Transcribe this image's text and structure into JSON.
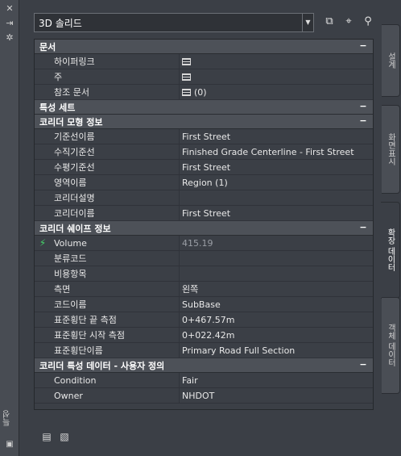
{
  "panel": {
    "title": "특성",
    "left_buttons": [
      {
        "icon": "close-icon",
        "glyph": "✕"
      },
      {
        "icon": "auto-hide-icon",
        "glyph": "⇥"
      },
      {
        "icon": "properties-settings-icon",
        "glyph": "✲"
      }
    ]
  },
  "toolbar": {
    "selector_value": "3D 솔리드",
    "dropdown_glyph": "▼",
    "icons": [
      {
        "name": "toggle-pickadd-icon",
        "glyph": "⧉"
      },
      {
        "name": "select-objects-icon",
        "glyph": "⌖"
      },
      {
        "name": "quick-select-icon",
        "glyph": "⚲"
      }
    ]
  },
  "sections": [
    {
      "title": "문서",
      "rows": [
        {
          "label": "하이퍼링크",
          "value": "",
          "icon": "table-icon"
        },
        {
          "label": "주",
          "value": "",
          "icon": "table-icon"
        },
        {
          "label": "참조 문서",
          "value": "(0)",
          "icon": "table-icon"
        }
      ]
    },
    {
      "title": "특성 세트",
      "rows": []
    },
    {
      "title": "코리더 모형 정보",
      "rows": [
        {
          "label": "기준선이름",
          "value": "First Street"
        },
        {
          "label": "수직기준선",
          "value": "Finished Grade Centerline - First Street"
        },
        {
          "label": "수평기준선",
          "value": "First Street"
        },
        {
          "label": "영역이름",
          "value": "Region (1)"
        },
        {
          "label": "코리더설명",
          "value": ""
        },
        {
          "label": "코리더이름",
          "value": "First Street"
        }
      ]
    },
    {
      "title": "코리더 쉐이프 정보",
      "rows": [
        {
          "label": "Volume",
          "value": "415.19",
          "dim": true,
          "lead_icon": "lightning-icon"
        },
        {
          "label": "분류코드",
          "value": ""
        },
        {
          "label": "비용항목",
          "value": ""
        },
        {
          "label": "측면",
          "value": "왼쪽"
        },
        {
          "label": "코드이름",
          "value": "SubBase"
        },
        {
          "label": "표준횡단 끝 측점",
          "value": "0+467.57m"
        },
        {
          "label": "표준횡단 시작 측점",
          "value": "0+022.42m"
        },
        {
          "label": "표준횡단이름",
          "value": "Primary Road Full Section"
        }
      ]
    },
    {
      "title": "코리더 특성 데이터 - 사용자 정의",
      "rows": [
        {
          "label": "Condition",
          "value": "Fair"
        },
        {
          "label": "Owner",
          "value": "NHDOT"
        }
      ]
    }
  ],
  "collapse_glyph": "−",
  "right_tabs": [
    {
      "label": "설계",
      "active": false
    },
    {
      "label": "화면표시",
      "active": false
    },
    {
      "label": "확장 데이터",
      "active": true
    },
    {
      "label": "객체 데이터",
      "active": false
    }
  ],
  "bottom_icons": [
    {
      "name": "attach-data-icon",
      "glyph": "▤"
    },
    {
      "name": "detach-data-icon",
      "glyph": "▧"
    }
  ]
}
